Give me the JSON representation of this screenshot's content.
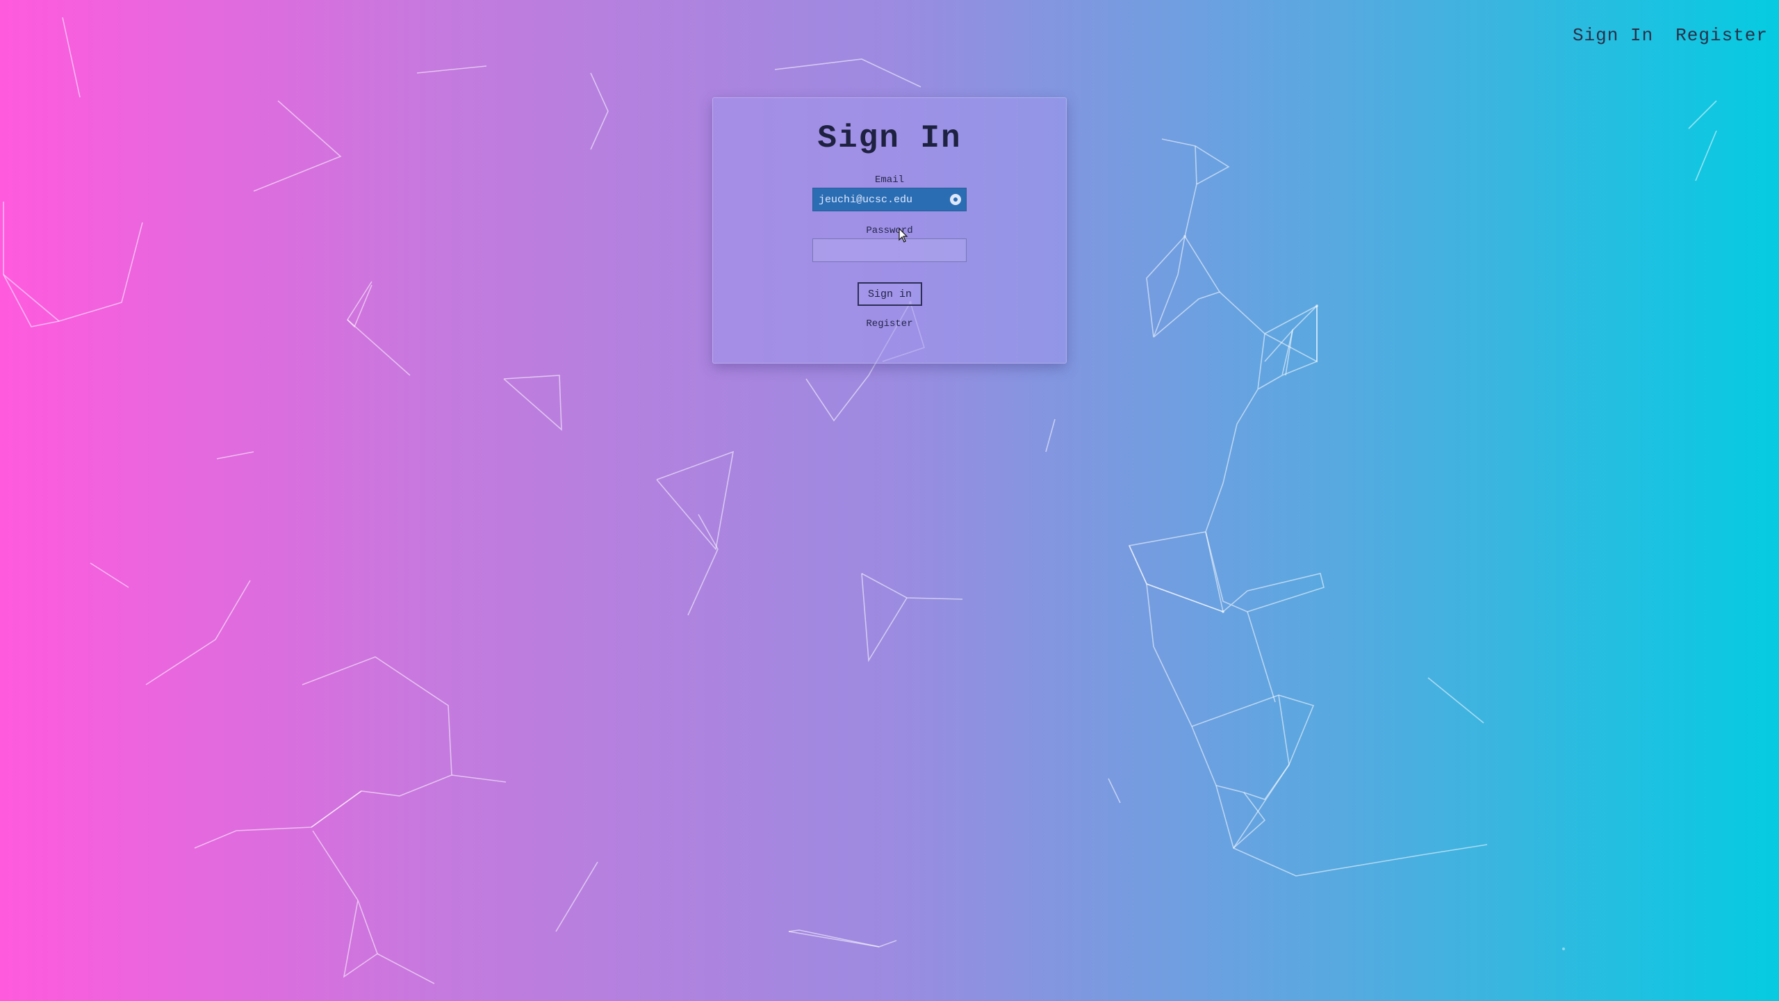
{
  "nav": {
    "sign_in": "Sign In",
    "register": "Register"
  },
  "form": {
    "title": "Sign In",
    "email_label": "Email",
    "email_value": "jeuchi@ucsc.edu",
    "password_label": "Password",
    "password_value": "",
    "submit_label": "Sign in",
    "register_link": "Register"
  },
  "colors": {
    "gradient_left": "#ff5ade",
    "gradient_right": "#05cbe1",
    "email_autofill_bg": "#2a6db3"
  }
}
